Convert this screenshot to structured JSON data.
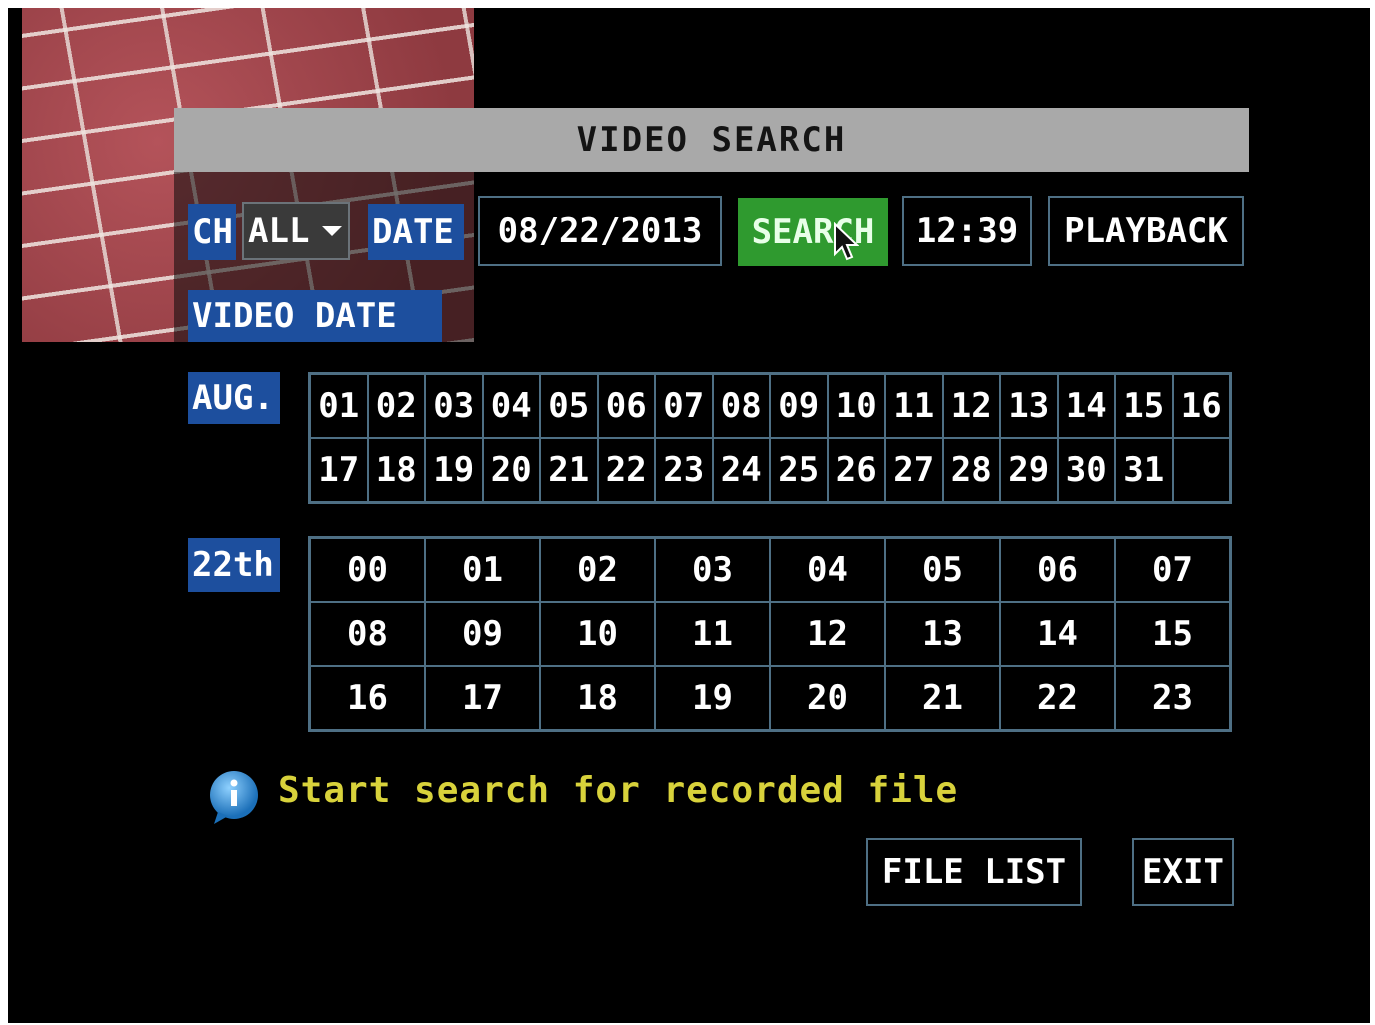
{
  "title": "VIDEO SEARCH",
  "filters": {
    "ch_label": "CH",
    "ch_value": "ALL",
    "date_label": "DATE",
    "date_value": "08/22/2013",
    "search_label": "SEARCH",
    "time_value": "12:39",
    "playback_label": "PLAYBACK"
  },
  "video_date_label": "VIDEO DATE",
  "month": {
    "label": "AUG.",
    "days": [
      "01",
      "02",
      "03",
      "04",
      "05",
      "06",
      "07",
      "08",
      "09",
      "10",
      "11",
      "12",
      "13",
      "14",
      "15",
      "16",
      "17",
      "18",
      "19",
      "20",
      "21",
      "22",
      "23",
      "24",
      "25",
      "26",
      "27",
      "28",
      "29",
      "30",
      "31",
      ""
    ]
  },
  "day": {
    "label": "22th",
    "hours": [
      "00",
      "01",
      "02",
      "03",
      "04",
      "05",
      "06",
      "07",
      "08",
      "09",
      "10",
      "11",
      "12",
      "13",
      "14",
      "15",
      "16",
      "17",
      "18",
      "19",
      "20",
      "21",
      "22",
      "23"
    ]
  },
  "info_text": "Start search for recorded file",
  "buttons": {
    "file_list": "FILE LIST",
    "exit": "EXIT"
  },
  "icons": {
    "info": "info-bubble-icon",
    "cursor": "mouse-pointer-icon"
  },
  "colors": {
    "label_bg": "#1d4f9e",
    "search_bg": "#2f9a2f",
    "border": "#4e6f84",
    "info_text": "#d8d23b"
  }
}
